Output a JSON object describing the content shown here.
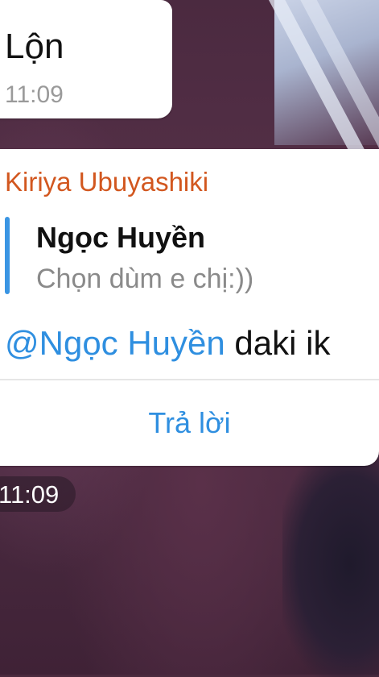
{
  "messages": {
    "previous": {
      "text": "Lộn",
      "time": "11:09"
    },
    "current": {
      "sender": "Kiriya Ubuyashiki",
      "reply_to": {
        "name": "Ngọc Huyền",
        "text": "Chọn dùm e chị:))"
      },
      "mention": "@Ngọc Huyền",
      "text_after_mention": " daki ik",
      "reply_button_label": "Trả lời",
      "time": "11:09"
    }
  },
  "colors": {
    "sender_name": "#d2571f",
    "accent_blue": "#2f8fe0",
    "reply_bar": "#3a95e3"
  }
}
